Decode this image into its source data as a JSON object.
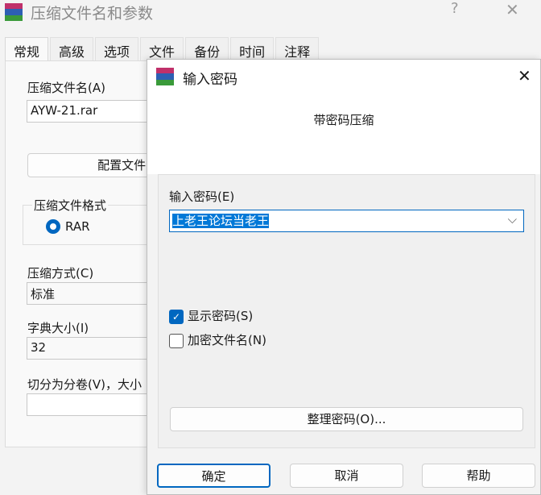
{
  "background_window": {
    "title": "压缩文件名和参数",
    "help_label": "?",
    "tabs": [
      "常规",
      "高级",
      "选项",
      "文件",
      "备份",
      "时间",
      "注释"
    ],
    "archive_name_label": "压缩文件名(A)",
    "archive_name_value": "AYW-21.rar",
    "profile_button": "配置文件(",
    "format_group_label": "压缩文件格式",
    "format_rar": "RAR",
    "method_label": "压缩方式(C)",
    "method_value": "标准",
    "dict_label": "字典大小(I)",
    "dict_value": "32",
    "split_label": "切分为分卷(V)，大小"
  },
  "dialog": {
    "title": "输入密码",
    "subtitle": "带密码压缩",
    "password_label": "输入密码(E)",
    "password_value": "上老王论坛当老王",
    "show_password_label": "显示密码(S)",
    "show_password_checked": true,
    "encrypt_names_label": "加密文件名(N)",
    "encrypt_names_checked": false,
    "organize_button": "整理密码(O)...",
    "ok_button": "确定",
    "cancel_button": "取消",
    "help_button": "帮助"
  },
  "colors": {
    "accent": "#0067c0",
    "selection": "#0078d7"
  }
}
